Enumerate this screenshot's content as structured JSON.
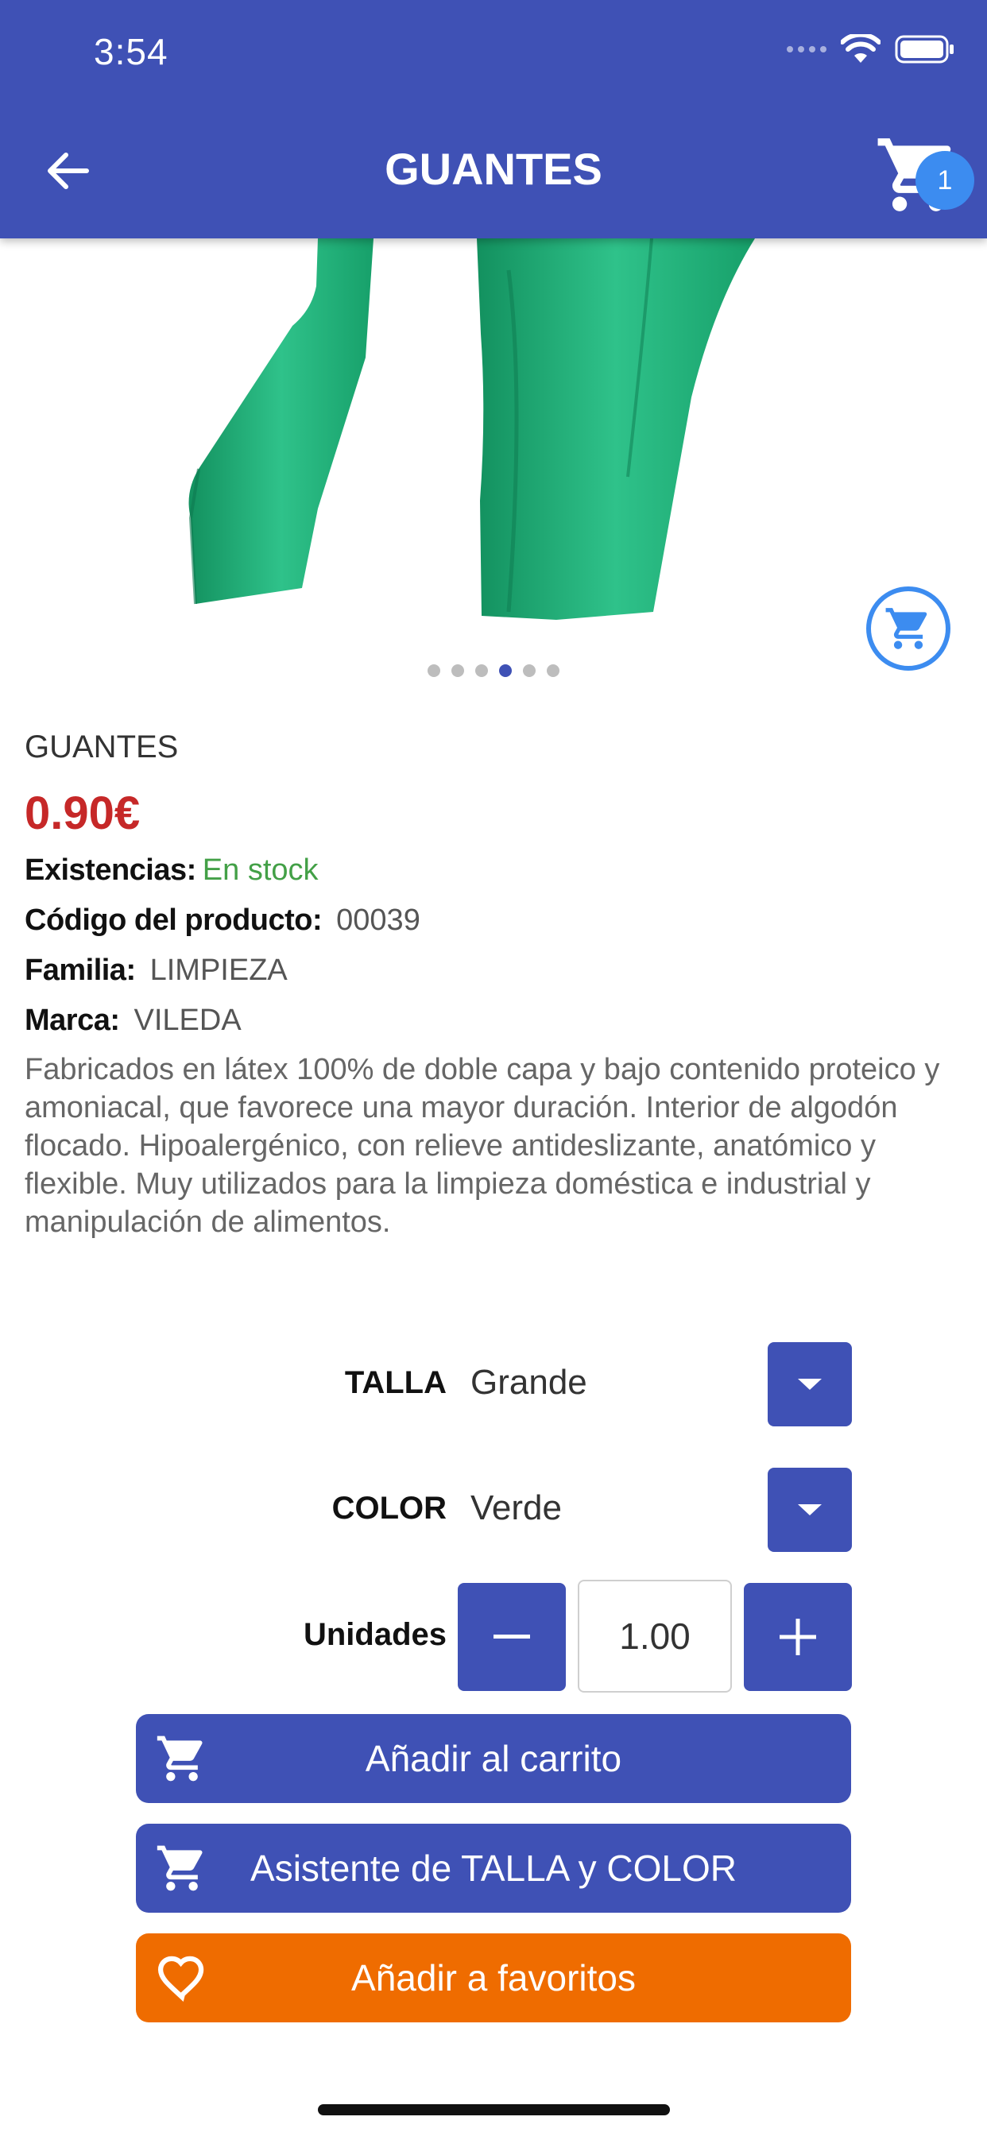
{
  "status_bar": {
    "time": "3:54"
  },
  "header": {
    "title": "GUANTES",
    "cart_count": "1"
  },
  "carousel": {
    "total_dots": 6,
    "active_index": 3
  },
  "product": {
    "name": "GUANTES",
    "price": "0.90€",
    "stock_label": "Existencias:",
    "stock_value": "En stock",
    "code_label": "Código del producto:",
    "code_value": "00039",
    "family_label": "Familia:",
    "family_value": "LIMPIEZA",
    "brand_label": "Marca:",
    "brand_value": "VILEDA",
    "description": "Fabricados en látex 100% de doble capa y bajo contenido proteico y amoniacal, que favorece una mayor duración. Interior de algodón flocado. Hipoalergénico, con relieve antideslizante, anatómico y flexible. Muy utilizados para la limpieza doméstica e industrial y manipulación de alimentos."
  },
  "options": {
    "size_label": "TALLA",
    "size_value": "Grande",
    "color_label": "COLOR",
    "color_value": "Verde",
    "units_label": "Unidades",
    "units_value": "1.00"
  },
  "actions": {
    "add_to_cart": "Añadir al carrito",
    "size_color_assistant": "Asistente de TALLA y COLOR",
    "add_to_favorites": "Añadir a favoritos"
  },
  "colors": {
    "primary": "#3f51b5",
    "price": "#c62828",
    "stock": "#43a047",
    "favorite": "#ef6c00",
    "badge": "#3c8cf0"
  }
}
